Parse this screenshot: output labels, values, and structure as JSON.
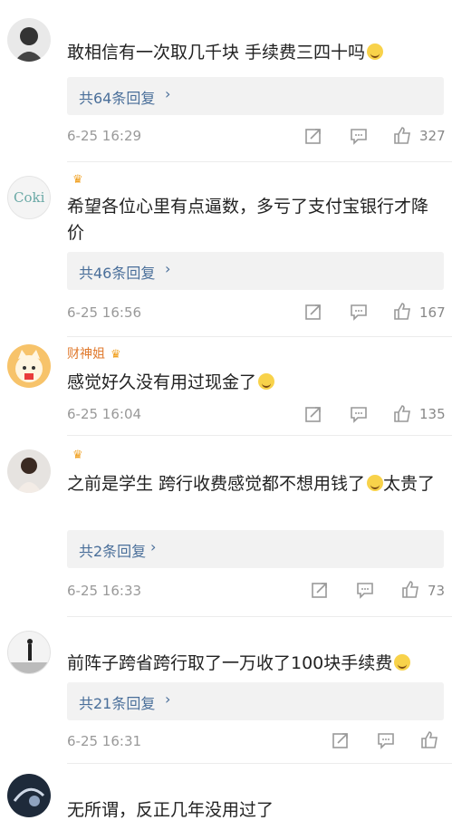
{
  "comments": [
    {
      "username": "",
      "text": "敢相信有一次取几千块  手续费三四十吗",
      "replies": "共64条回复",
      "time": "6-25 16:29",
      "likes": "327"
    },
    {
      "username": "",
      "text": "希望各位心里有点逼数，多亏了支付宝银行才降价",
      "replies": "共46条回复",
      "time": "6-25 16:56",
      "likes": "167",
      "avatar_text": "Coki"
    },
    {
      "username": "财神姐",
      "text": "感觉好久没有用过现金了",
      "replies": "",
      "time": "6-25 16:04",
      "likes": "135"
    },
    {
      "username": "",
      "text": "之前是学生 跨行收费感觉都不想用钱了",
      "text_extra": "太贵了",
      "replies": "共2条回复",
      "time": "6-25 16:33",
      "likes": "73"
    },
    {
      "username": "",
      "text": "前阵子跨省跨行取了一万收了100块手续费",
      "replies": "共21条回复",
      "time": "6-25 16:31",
      "likes": ""
    },
    {
      "username": "",
      "text": "无所谓，反正几年没用过了",
      "replies": "",
      "time": "",
      "likes": ""
    }
  ],
  "icons": {
    "forward": "share-icon",
    "comment": "comment-icon",
    "like": "thumbs-up-icon"
  },
  "colors": {
    "link": "#4a6f9a",
    "username_vip": "#e07a2e",
    "muted": "#999999"
  }
}
